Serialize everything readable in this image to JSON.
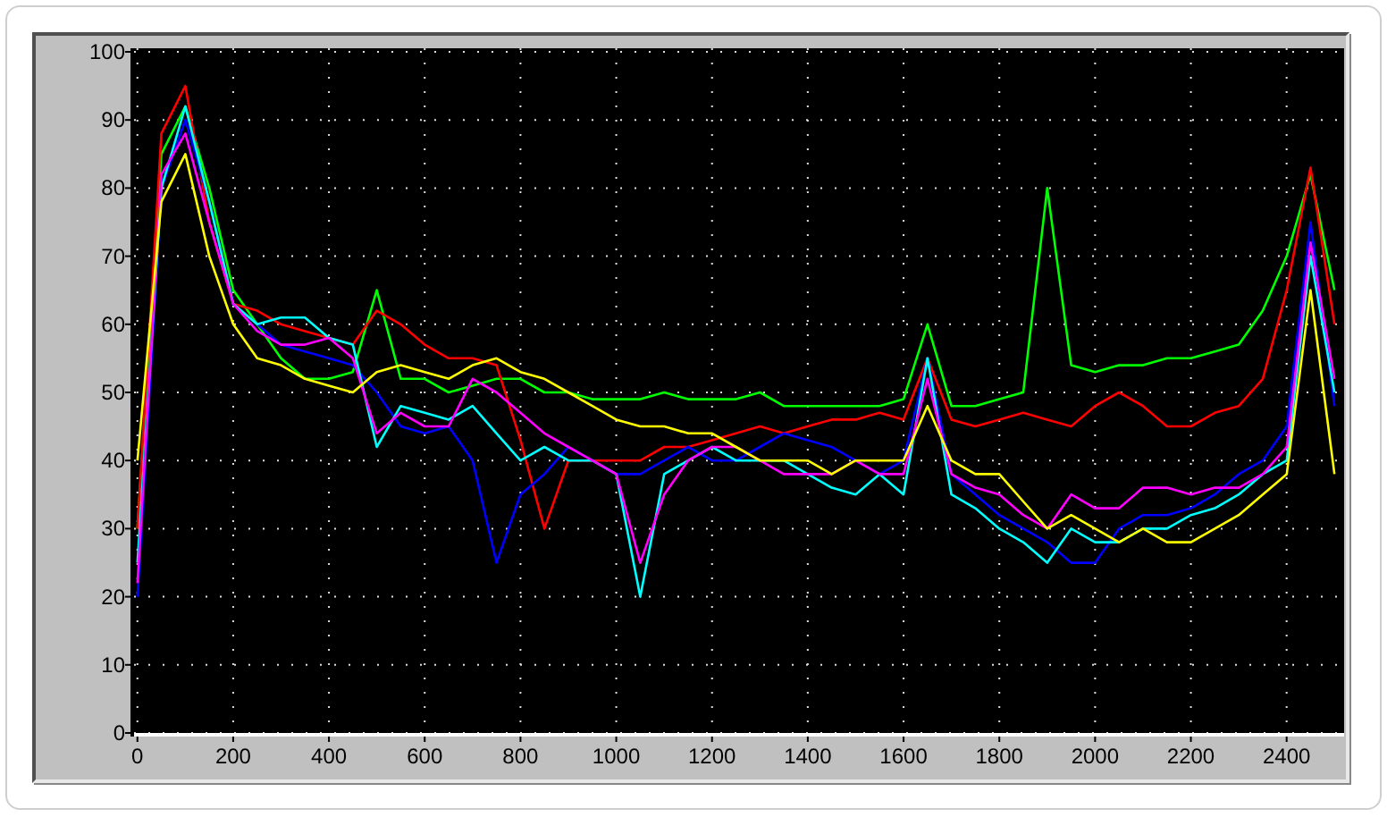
{
  "chart_data": {
    "type": "line",
    "x": [
      0,
      50,
      100,
      150,
      200,
      250,
      300,
      350,
      400,
      450,
      500,
      550,
      600,
      650,
      700,
      750,
      800,
      850,
      900,
      950,
      1000,
      1050,
      1100,
      1150,
      1200,
      1250,
      1300,
      1350,
      1400,
      1450,
      1500,
      1550,
      1600,
      1650,
      1700,
      1750,
      1800,
      1850,
      1900,
      1950,
      2000,
      2050,
      2100,
      2150,
      2200,
      2250,
      2300,
      2350,
      2400,
      2450,
      2500
    ],
    "series": [
      {
        "color": "#00ff00",
        "values": [
          30,
          85,
          92,
          80,
          65,
          60,
          55,
          52,
          52,
          53,
          65,
          52,
          52,
          50,
          51,
          52,
          52,
          50,
          50,
          49,
          49,
          49,
          50,
          49,
          49,
          49,
          50,
          48,
          48,
          48,
          48,
          48,
          49,
          60,
          48,
          48,
          49,
          50,
          80,
          54,
          53,
          54,
          54,
          55,
          55,
          56,
          57,
          62,
          70,
          82,
          65
        ]
      },
      {
        "color": "#ff0000",
        "values": [
          30,
          88,
          95,
          75,
          63,
          62,
          60,
          59,
          58,
          57,
          62,
          60,
          57,
          55,
          55,
          54,
          43,
          30,
          40,
          40,
          40,
          40,
          42,
          42,
          43,
          44,
          45,
          44,
          45,
          46,
          46,
          47,
          46,
          55,
          46,
          45,
          46,
          47,
          46,
          45,
          48,
          50,
          48,
          45,
          45,
          47,
          48,
          52,
          65,
          83,
          60
        ]
      },
      {
        "color": "#0000ff",
        "values": [
          20,
          80,
          90,
          78,
          63,
          60,
          57,
          56,
          55,
          54,
          50,
          45,
          44,
          45,
          40,
          25,
          35,
          38,
          42,
          40,
          38,
          38,
          40,
          42,
          40,
          40,
          42,
          44,
          43,
          42,
          40,
          38,
          40,
          55,
          38,
          35,
          32,
          30,
          28,
          25,
          25,
          30,
          32,
          32,
          33,
          35,
          38,
          40,
          45,
          75,
          48
        ]
      },
      {
        "color": "#00ffff",
        "values": [
          25,
          80,
          92,
          78,
          63,
          60,
          61,
          61,
          58,
          57,
          42,
          48,
          47,
          46,
          48,
          44,
          40,
          42,
          40,
          40,
          38,
          20,
          38,
          40,
          42,
          40,
          40,
          40,
          38,
          36,
          35,
          38,
          35,
          55,
          35,
          33,
          30,
          28,
          25,
          30,
          28,
          28,
          30,
          30,
          32,
          33,
          35,
          38,
          40,
          70,
          50
        ]
      },
      {
        "color": "#ff00ff",
        "values": [
          22,
          82,
          88,
          75,
          63,
          59,
          57,
          57,
          58,
          55,
          44,
          47,
          45,
          45,
          52,
          50,
          47,
          44,
          42,
          40,
          38,
          25,
          35,
          40,
          42,
          42,
          40,
          38,
          38,
          38,
          40,
          38,
          38,
          52,
          38,
          36,
          35,
          32,
          30,
          35,
          33,
          33,
          36,
          36,
          35,
          36,
          36,
          38,
          42,
          72,
          52
        ]
      },
      {
        "color": "#ffff00",
        "values": [
          40,
          78,
          85,
          70,
          60,
          55,
          54,
          52,
          51,
          50,
          53,
          54,
          53,
          52,
          54,
          55,
          53,
          52,
          50,
          48,
          46,
          45,
          45,
          44,
          44,
          42,
          40,
          40,
          40,
          38,
          40,
          40,
          40,
          48,
          40,
          38,
          38,
          34,
          30,
          32,
          30,
          28,
          30,
          28,
          28,
          30,
          32,
          35,
          38,
          65,
          38
        ]
      }
    ],
    "grid": true,
    "xlim": [
      -7,
      2520
    ],
    "ylim": [
      0,
      100
    ],
    "xticks": [
      0,
      200,
      400,
      600,
      800,
      1000,
      1200,
      1400,
      1600,
      1800,
      2000,
      2200,
      2400
    ],
    "yticks": [
      0,
      10,
      20,
      30,
      40,
      50,
      60,
      70,
      80,
      90,
      100
    ]
  }
}
